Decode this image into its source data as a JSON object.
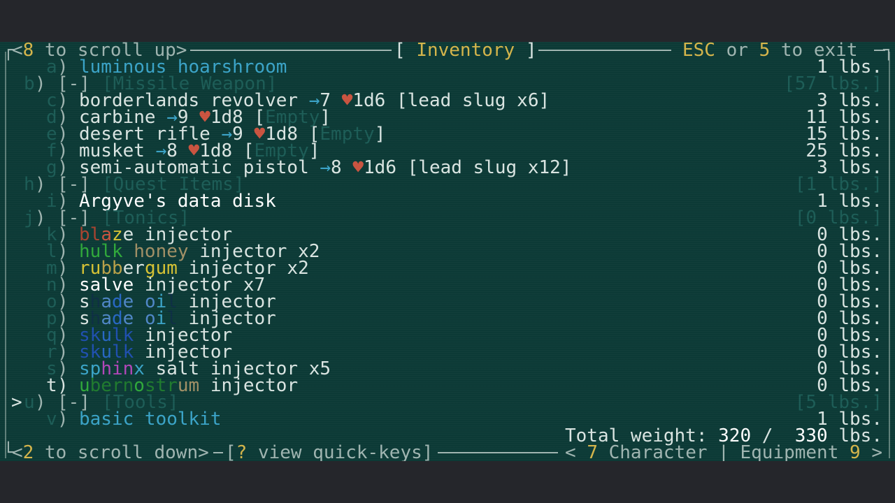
{
  "header": {
    "scroll_up_key": "8",
    "scroll_up_label": " to scroll up>",
    "title_open": "[ ",
    "title": "Inventory",
    "title_close": " ]",
    "exit_key1": "ESC",
    "exit_or": " or ",
    "exit_key2": "5",
    "exit_label": " to exit"
  },
  "items": {
    "a": {
      "letter": "a",
      "name": "luminous hoarshroom",
      "weight": "1 lbs."
    },
    "b": {
      "letter": "b",
      "toggle": "[-]",
      "category": "[Missile Weapon]",
      "weight": "[57 lbs.]"
    },
    "c": {
      "letter": "c",
      "name": "borderlands revolver",
      "pv_icon": "→",
      "pv": "7",
      "dmg_icon": "♥",
      "dmg": "1d6",
      "ammo": "[lead slug x6]",
      "weight": "3 lbs."
    },
    "d": {
      "letter": "d",
      "name": "carbine",
      "pv_icon": "→",
      "pv": "9",
      "dmg_icon": "♥",
      "dmg": "1d8",
      "ammo_open": "[",
      "ammo_state": "Empty",
      "ammo_close": "]",
      "weight": "11 lbs."
    },
    "e": {
      "letter": "e",
      "name": "desert rifle",
      "pv_icon": "→",
      "pv": "9",
      "dmg_icon": "♥",
      "dmg": "1d8",
      "ammo_open": "[",
      "ammo_state": "Empty",
      "ammo_close": "]",
      "weight": "15 lbs."
    },
    "f": {
      "letter": "f",
      "name": "musket",
      "pv_icon": "→",
      "pv": "8",
      "dmg_icon": "♥",
      "dmg": "1d8",
      "ammo_open": "[",
      "ammo_state": "Empty",
      "ammo_close": "]",
      "weight": "25 lbs."
    },
    "g": {
      "letter": "g",
      "name": "semi-automatic pistol",
      "pv_icon": "→",
      "pv": "8",
      "dmg_icon": "♥",
      "dmg": "1d6",
      "ammo": "[lead slug x12]",
      "weight": "3 lbs."
    },
    "h": {
      "letter": "h",
      "toggle": "[-]",
      "category": "[Quest Items]",
      "weight": "[1 lbs.]"
    },
    "i": {
      "letter": "i",
      "name": "Argyve's data disk",
      "weight": "1 lbs."
    },
    "j": {
      "letter": "j",
      "toggle": "[-]",
      "category": "[Tonics]",
      "weight": "[0 lbs.]"
    },
    "k": {
      "letter": "k",
      "name_segments": [
        "bl",
        "a",
        "z",
        "e"
      ],
      "suffix": " injector",
      "weight": "0 lbs."
    },
    "l": {
      "letter": "l",
      "name_segments": [
        "hulk",
        " ",
        "honey"
      ],
      "suffix": " injector x2",
      "weight": "0 lbs."
    },
    "m": {
      "letter": "m",
      "name_segments": [
        "ru",
        "bb",
        "er",
        "gum"
      ],
      "suffix": " injector x2",
      "weight": "0 lbs."
    },
    "n": {
      "letter": "n",
      "name": "salve",
      "suffix": " injector x7",
      "weight": "0 lbs."
    },
    "o": {
      "letter": "o",
      "name_segments": [
        "s",
        "h",
        "a",
        "d",
        "e",
        " ",
        "o",
        "i",
        "l"
      ],
      "suffix": " injector",
      "weight": "0 lbs."
    },
    "p": {
      "letter": "p",
      "name_segments": [
        "s",
        "h",
        "a",
        "d",
        "e",
        " ",
        "o",
        "i",
        "l"
      ],
      "suffix": " injector",
      "weight": "0 lbs."
    },
    "q": {
      "letter": "q",
      "name_segments": [
        "sk",
        "u",
        "lk"
      ],
      "suffix": " injector",
      "weight": "0 lbs."
    },
    "r": {
      "letter": "r",
      "name_segments": [
        "sk",
        "u",
        "lk"
      ],
      "suffix": " injector",
      "weight": "0 lbs."
    },
    "s": {
      "letter": "s",
      "name_segments": [
        "sp",
        "hin",
        "x"
      ],
      "suffix": " salt injector x5",
      "weight": "0 lbs."
    },
    "t": {
      "letter": "t",
      "cursor": ">",
      "name_segments": [
        "u",
        "bern",
        "o",
        "str",
        "um"
      ],
      "suffix": " injector",
      "weight": "0 lbs."
    },
    "u": {
      "letter": "u",
      "toggle": "[-]",
      "category": "[Tools]",
      "weight": "[5 lbs.]"
    },
    "v": {
      "letter": "v",
      "name": "basic toolkit",
      "weight": "1 lbs."
    }
  },
  "total": {
    "label": "Total weight: ",
    "current": "320",
    "sep": " /  ",
    "max": "330",
    "unit": " lbs."
  },
  "footer": {
    "scroll_down_key": "2",
    "scroll_down_label": " to scroll down>",
    "quick_open": "[",
    "quick_key": "?",
    "quick_label": " view quick-keys]",
    "nav_left_open": "< ",
    "nav_left_key": "7",
    "nav_left_label": " Character",
    "nav_sep": " | ",
    "nav_right_label": "Equipment ",
    "nav_right_key": "9",
    "nav_right_close": " >"
  },
  "colors": {
    "background": "#0c3a36",
    "text": "#d9e4e1",
    "key_highlight": "#d4b44a",
    "dim": "#1c5c56",
    "pv_cyan": "#3aa3c7",
    "damage_red": "#c9533f",
    "tonic_blaze": "#c9533f",
    "tonic_hulk": "#2fa83a",
    "tonic_honey": "#a08f65",
    "tonic_rubbergum": "#d6c233",
    "tonic_shade": "#2767c4",
    "tonic_sphinx": "#b146b8",
    "tonic_ubernostrum": "#2fa83a"
  }
}
